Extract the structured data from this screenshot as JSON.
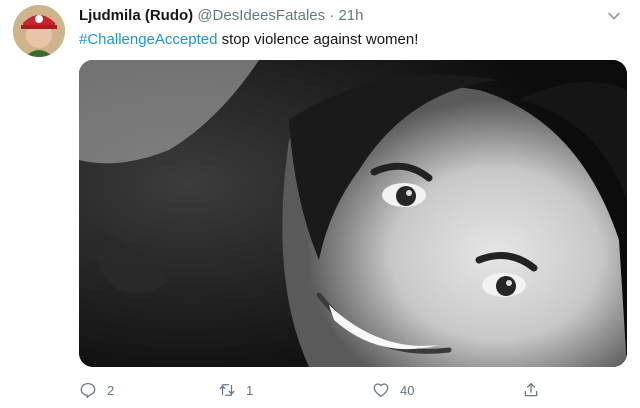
{
  "author": {
    "display_name": "Ljudmila (Rudo)",
    "handle": "@DesIdeesFatales",
    "separator": "·",
    "time": "21h",
    "avatar_icon": "profile-photo-avatar"
  },
  "tweet": {
    "hashtag": "#ChallengeAccepted",
    "text": " stop violence against women!"
  },
  "media": {
    "kind": "black-and-white selfie photo"
  },
  "actions": {
    "reply_count": "2",
    "retweet_count": "1",
    "like_count": "40",
    "share_count": ""
  },
  "colors": {
    "hashtag": "#1b95e0",
    "meta_gray": "#657786",
    "text": "#14171a"
  }
}
